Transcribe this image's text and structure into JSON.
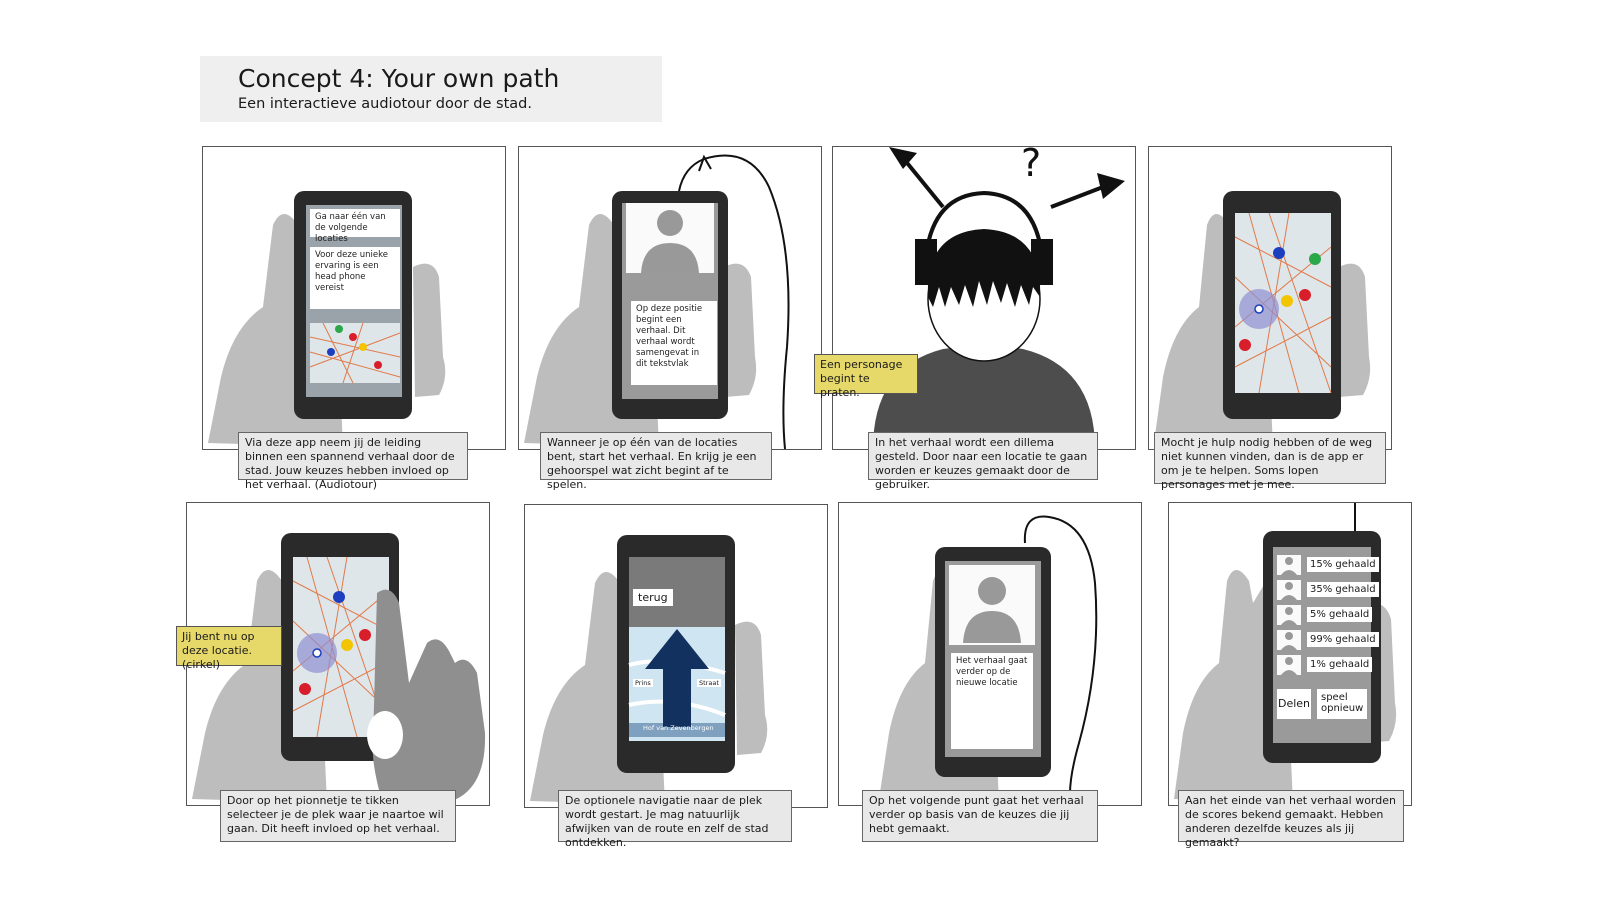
{
  "header": {
    "title": "Concept 4: Your own path",
    "subtitle": "Een interactieve audiotour door de stad."
  },
  "panels": [
    {
      "caption": "Via deze app neem jij de leiding binnen een spannend verhaal door de stad. Jouw keuzes hebben invloed op het verhaal. (Audiotour)",
      "screen_text_1": "Ga naar één van de volgende locaties",
      "screen_text_2": "Voor deze unieke ervaring is een head phone vereist"
    },
    {
      "caption": "Wanneer je op één van de locaties bent, start het verhaal. En krijg je een gehoorspel wat zicht begint af te spelen.",
      "screen_text": "Op deze positie begint een verhaal. Dit verhaal wordt samengevat in dit tekstvlak"
    },
    {
      "caption": "In het verhaal wordt een dillema gesteld. Door naar een locatie te gaan worden er keuzes gemaakt door de gebruiker.",
      "note": "Een personage begint te praten.",
      "question_mark": "?"
    },
    {
      "caption": "Mocht je hulp nodig hebben of de weg niet kunnen vinden, dan is de app er om je te helpen.  Soms lopen personages met je mee."
    },
    {
      "caption": "Door op het pionnetje te tikken selecteer je de plek waar je naartoe wil gaan. Dit heeft invloed op het verhaal.",
      "note": "Jij bent nu op deze locatie. (cirkel)"
    },
    {
      "caption": "De optionele navigatie naar de plek wordt gestart. Je mag natuurlijk afwijken van de route en zelf de stad ontdekken.",
      "back_button": "terug",
      "street_label": "Hof van Zevenbergen",
      "street_sign_1": "Prins",
      "street_sign_2": "Straat"
    },
    {
      "caption": "Op het volgende punt gaat het verhaal verder op basis van de keuzes die jij hebt gemaakt.",
      "screen_text": "Het verhaal gaat verder op de nieuwe locatie"
    },
    {
      "caption": "Aan het einde van het verhaal worden de scores bekend gemaakt. Hebben anderen dezelfde keuzes als jij gemaakt?",
      "scores": [
        "15% gehaald",
        "35% gehaald",
        "5% gehaald",
        "99% gehaald",
        "1% gehaald"
      ],
      "share_button": "Delen",
      "replay_button": "speel opnieuw"
    }
  ],
  "colors": {
    "hand": "#bdbdbd",
    "phone": "#2a2a2a",
    "note": "#e6d96a",
    "caption_bg": "#e8e8e8",
    "pin_red": "#d81e2a",
    "pin_blue": "#1d3fbf",
    "pin_yellow": "#f2c500",
    "pin_green": "#2aa84a",
    "arrow_blue": "#13315e"
  }
}
